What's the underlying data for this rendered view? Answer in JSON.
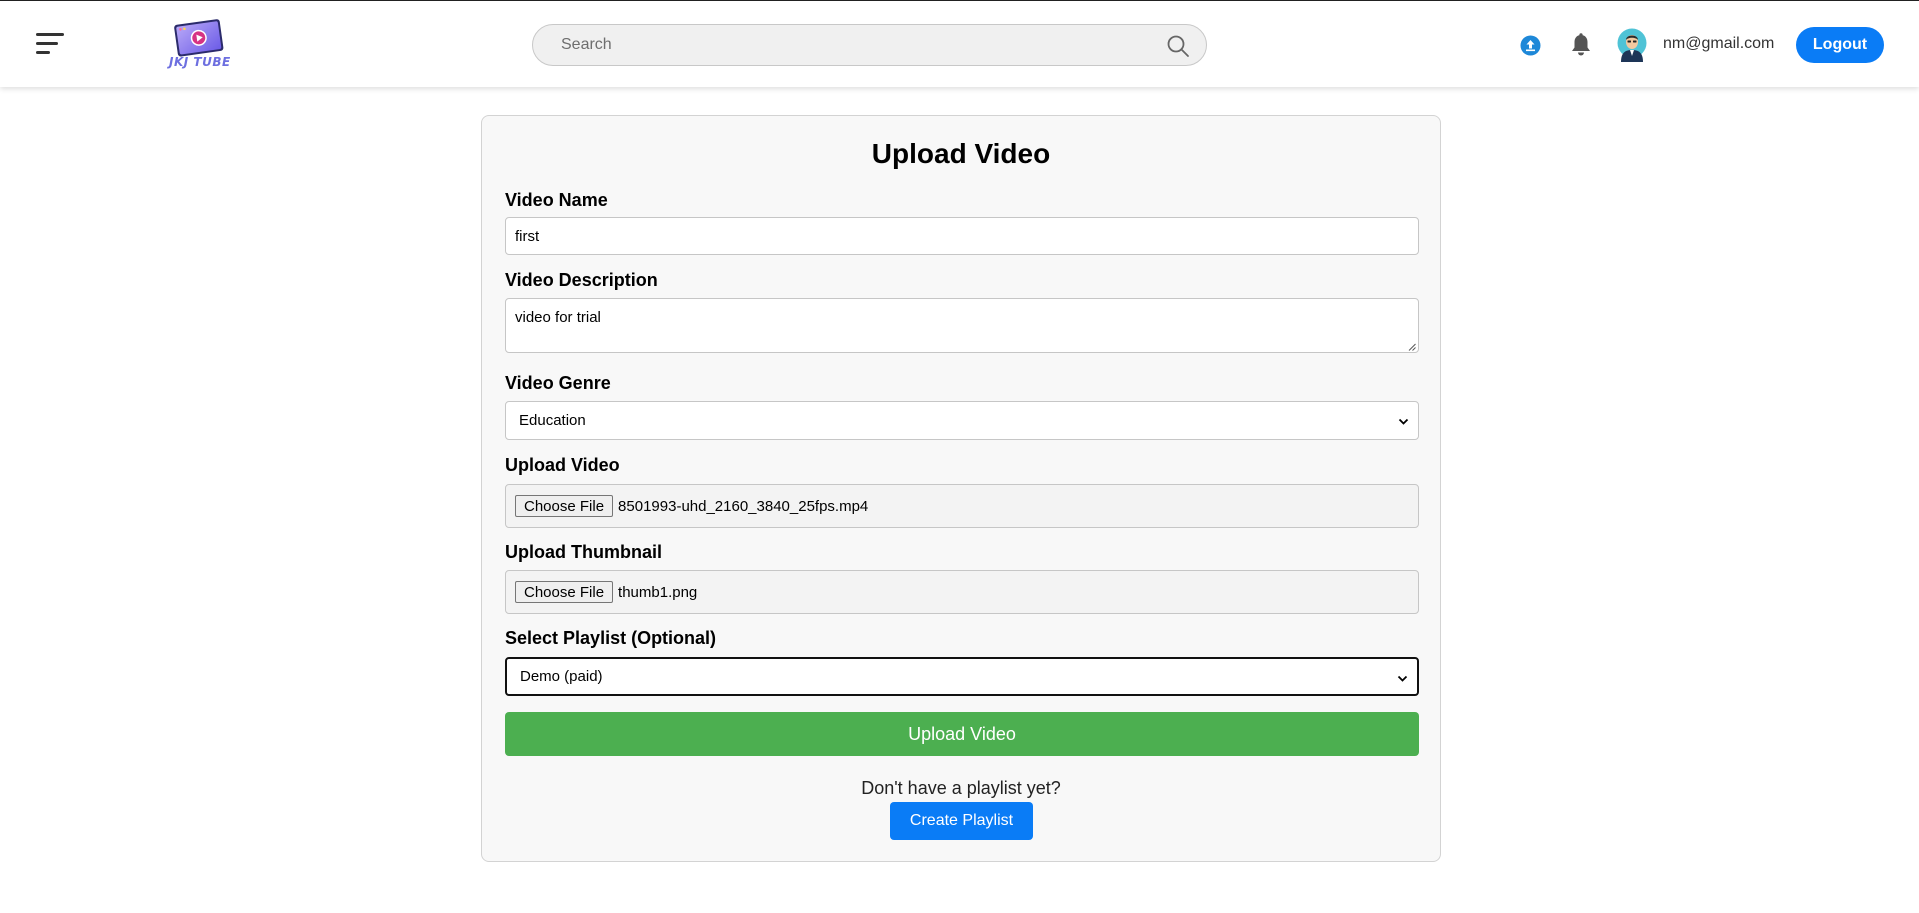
{
  "header": {
    "logo_text": "JKJ TUBE",
    "search_placeholder": "Search",
    "email": "nm@gmail.com",
    "logout_label": "Logout"
  },
  "form": {
    "title": "Upload Video",
    "video_name": {
      "label": "Video Name",
      "value": "first"
    },
    "video_description": {
      "label": "Video Description",
      "value": "video for trial"
    },
    "video_genre": {
      "label": "Video Genre",
      "selected": "Education"
    },
    "upload_video": {
      "label": "Upload Video",
      "button": "Choose File",
      "filename": "8501993-uhd_2160_3840_25fps.mp4"
    },
    "upload_thumbnail": {
      "label": "Upload Thumbnail",
      "button": "Choose File",
      "filename": "thumb1.png"
    },
    "playlist": {
      "label": "Select Playlist (Optional)",
      "selected": "Demo (paid)"
    },
    "submit_label": "Upload Video",
    "no_playlist_text": "Don't have a playlist yet?",
    "create_playlist_label": "Create Playlist"
  },
  "colors": {
    "primary_blue": "#0a7cf6",
    "submit_green": "#4caf50",
    "card_bg": "#f8f8f8"
  },
  "icons": {
    "menu": "hamburger-icon",
    "search": "search-icon",
    "upload": "upload-icon",
    "notifications": "bell-icon",
    "avatar": "avatar"
  }
}
